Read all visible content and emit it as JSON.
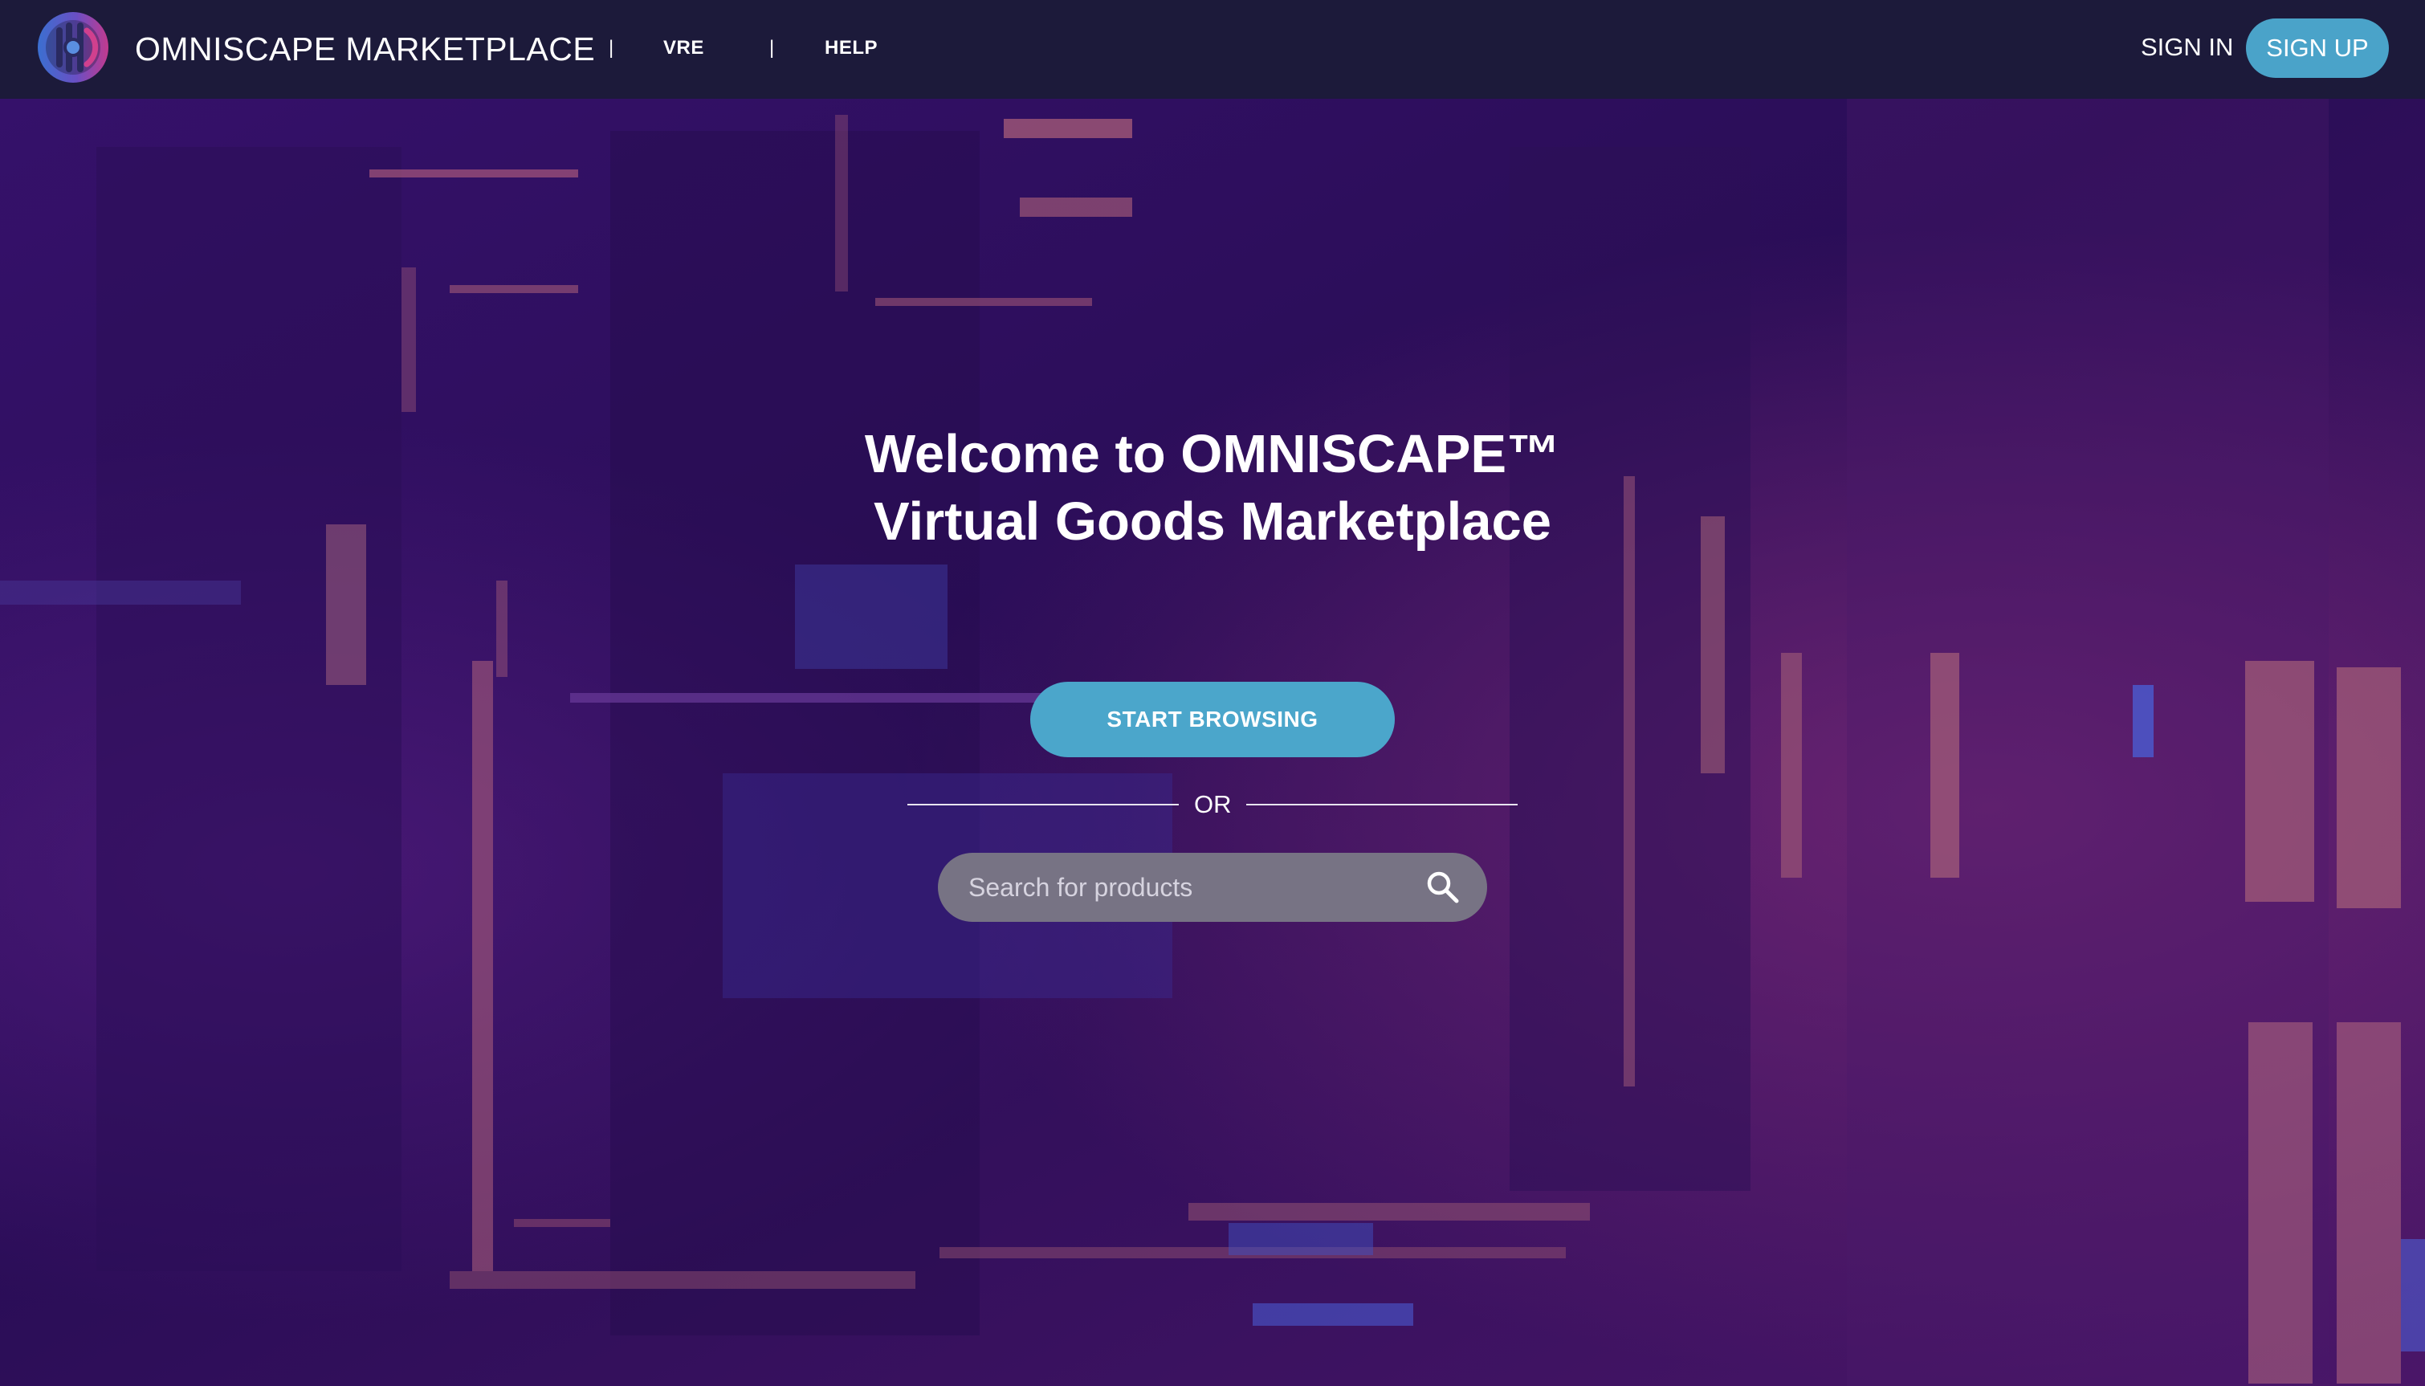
{
  "header": {
    "brand": "OMNISCAPE MARKETPLACE",
    "nav": {
      "separator": "|",
      "vre_label": "VRE",
      "help_label": "HELP"
    },
    "sign_in_label": "SIGN IN",
    "sign_up_label": "SIGN UP",
    "logo_icon": "omniscape-logo-icon"
  },
  "hero": {
    "title_line1": "Welcome to OMNISCAPE™",
    "title_line2": "Virtual Goods Marketplace",
    "start_label": "START BROWSING",
    "or_label": "OR",
    "search": {
      "placeholder": "Search for products",
      "value": "",
      "icon": "search-icon"
    }
  },
  "colors": {
    "header_bg": "#1c1a3a",
    "accent": "#4aa3c9",
    "background": "#2a0f55",
    "search_bg": "#777384"
  }
}
